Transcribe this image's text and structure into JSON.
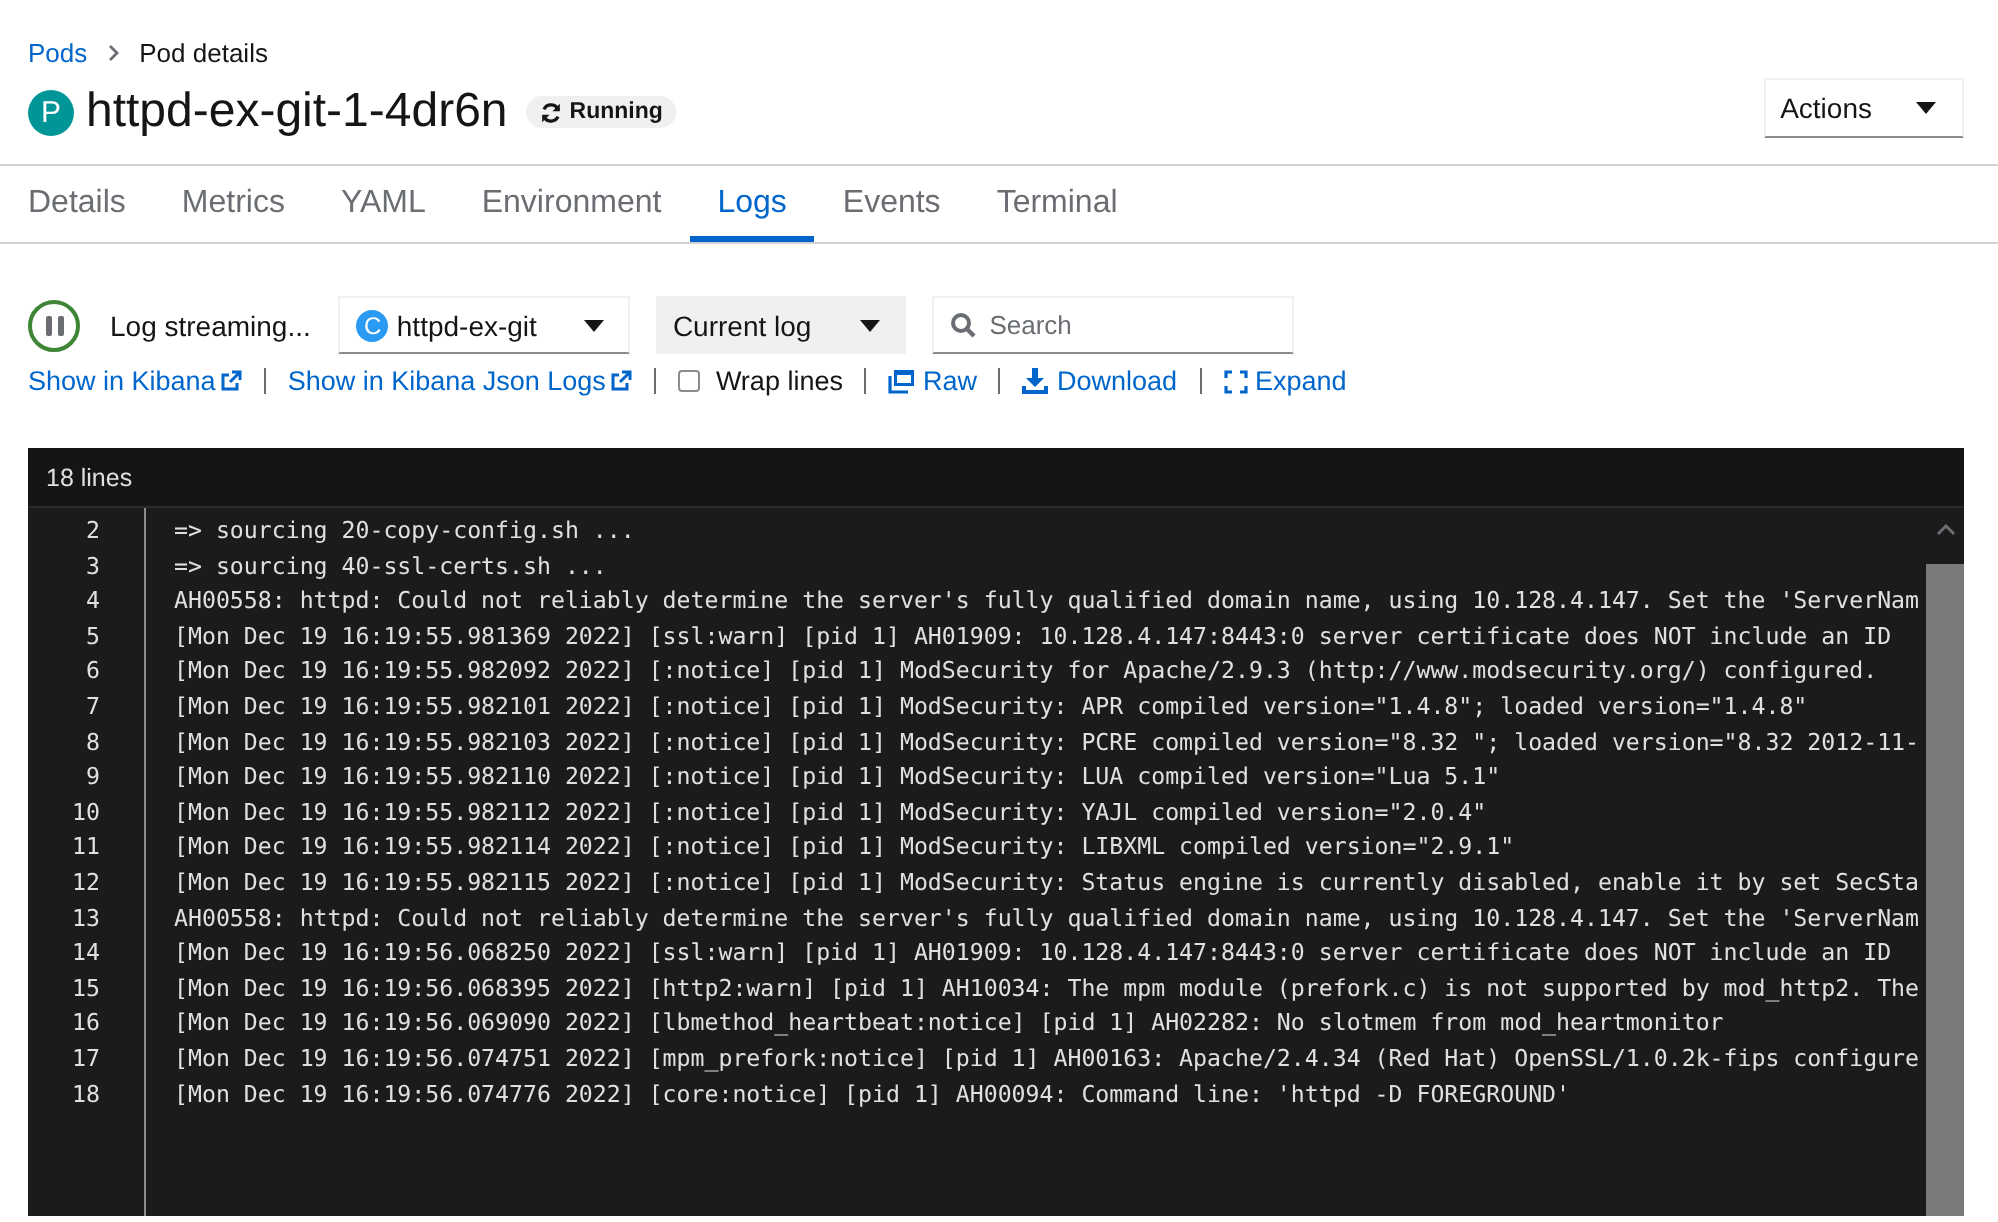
{
  "breadcrumb": [
    {
      "label": "Pods",
      "kind": "link"
    },
    {
      "label": "Pod details",
      "kind": "current"
    }
  ],
  "title": {
    "badge": "P",
    "name": "httpd-ex-git-1-4dr6n",
    "status": "Running"
  },
  "actions": {
    "label": "Actions"
  },
  "tabs": [
    {
      "label": "Details",
      "selected": false
    },
    {
      "label": "Metrics",
      "selected": false
    },
    {
      "label": "YAML",
      "selected": false
    },
    {
      "label": "Environment",
      "selected": false
    },
    {
      "label": "Logs",
      "selected": true
    },
    {
      "label": "Events",
      "selected": false
    },
    {
      "label": "Terminal",
      "selected": false
    }
  ],
  "toolbar": {
    "status": "Log streaming...",
    "container": {
      "badge": "C",
      "label": "httpd-ex-git"
    },
    "log_select": "Current log",
    "search": {
      "placeholder": "Search"
    }
  },
  "links": [
    {
      "label": "Show in Kibana",
      "kind": "external"
    },
    {
      "label": "Show in Kibana Json Logs",
      "kind": "external"
    },
    {
      "label": "Wrap lines",
      "kind": "checkbox",
      "checked": false
    },
    {
      "label": "Raw",
      "kind": "raw"
    },
    {
      "label": "Download",
      "kind": "download"
    },
    {
      "label": "Expand",
      "kind": "expand"
    }
  ],
  "log": {
    "count": "18 lines",
    "lines": [
      {
        "number": "2",
        "text": "=> sourcing 20-copy-config.sh ..."
      },
      {
        "number": "3",
        "text": "=> sourcing 40-ssl-certs.sh ..."
      },
      {
        "number": "4",
        "text": "AH00558: httpd: Could not reliably determine the server's fully qualified domain name, using 10.128.4.147. Set the 'ServerNam"
      },
      {
        "number": "5",
        "text": "[Mon Dec 19 16:19:55.981369 2022] [ssl:warn] [pid 1] AH01909: 10.128.4.147:8443:0 server certificate does NOT include an ID"
      },
      {
        "number": "6",
        "text": "[Mon Dec 19 16:19:55.982092 2022] [:notice] [pid 1] ModSecurity for Apache/2.9.3 (http://www.modsecurity.org/) configured."
      },
      {
        "number": "7",
        "text": "[Mon Dec 19 16:19:55.982101 2022] [:notice] [pid 1] ModSecurity: APR compiled version=\"1.4.8\"; loaded version=\"1.4.8\""
      },
      {
        "number": "8",
        "text": "[Mon Dec 19 16:19:55.982103 2022] [:notice] [pid 1] ModSecurity: PCRE compiled version=\"8.32 \"; loaded version=\"8.32 2012-11-"
      },
      {
        "number": "9",
        "text": "[Mon Dec 19 16:19:55.982110 2022] [:notice] [pid 1] ModSecurity: LUA compiled version=\"Lua 5.1\""
      },
      {
        "number": "10",
        "text": "[Mon Dec 19 16:19:55.982112 2022] [:notice] [pid 1] ModSecurity: YAJL compiled version=\"2.0.4\""
      },
      {
        "number": "11",
        "text": "[Mon Dec 19 16:19:55.982114 2022] [:notice] [pid 1] ModSecurity: LIBXML compiled version=\"2.9.1\""
      },
      {
        "number": "12",
        "text": "[Mon Dec 19 16:19:55.982115 2022] [:notice] [pid 1] ModSecurity: Status engine is currently disabled, enable it by set SecSta"
      },
      {
        "number": "13",
        "text": "AH00558: httpd: Could not reliably determine the server's fully qualified domain name, using 10.128.4.147. Set the 'ServerNam"
      },
      {
        "number": "14",
        "text": "[Mon Dec 19 16:19:56.068250 2022] [ssl:warn] [pid 1] AH01909: 10.128.4.147:8443:0 server certificate does NOT include an ID"
      },
      {
        "number": "15",
        "text": "[Mon Dec 19 16:19:56.068395 2022] [http2:warn] [pid 1] AH10034: The mpm module (prefork.c) is not supported by mod_http2. The"
      },
      {
        "number": "16",
        "text": "[Mon Dec 19 16:19:56.069090 2022] [lbmethod_heartbeat:notice] [pid 1] AH02282: No slotmem from mod_heartmonitor"
      },
      {
        "number": "17",
        "text": "[Mon Dec 19 16:19:56.074751 2022] [mpm_prefork:notice] [pid 1] AH00163: Apache/2.4.34 (Red Hat) OpenSSL/1.0.2k-fips configure"
      },
      {
        "number": "18",
        "text": "[Mon Dec 19 16:19:56.074776 2022] [core:notice] [pid 1] AH00094: Command line: 'httpd -D FOREGROUND'"
      }
    ]
  }
}
